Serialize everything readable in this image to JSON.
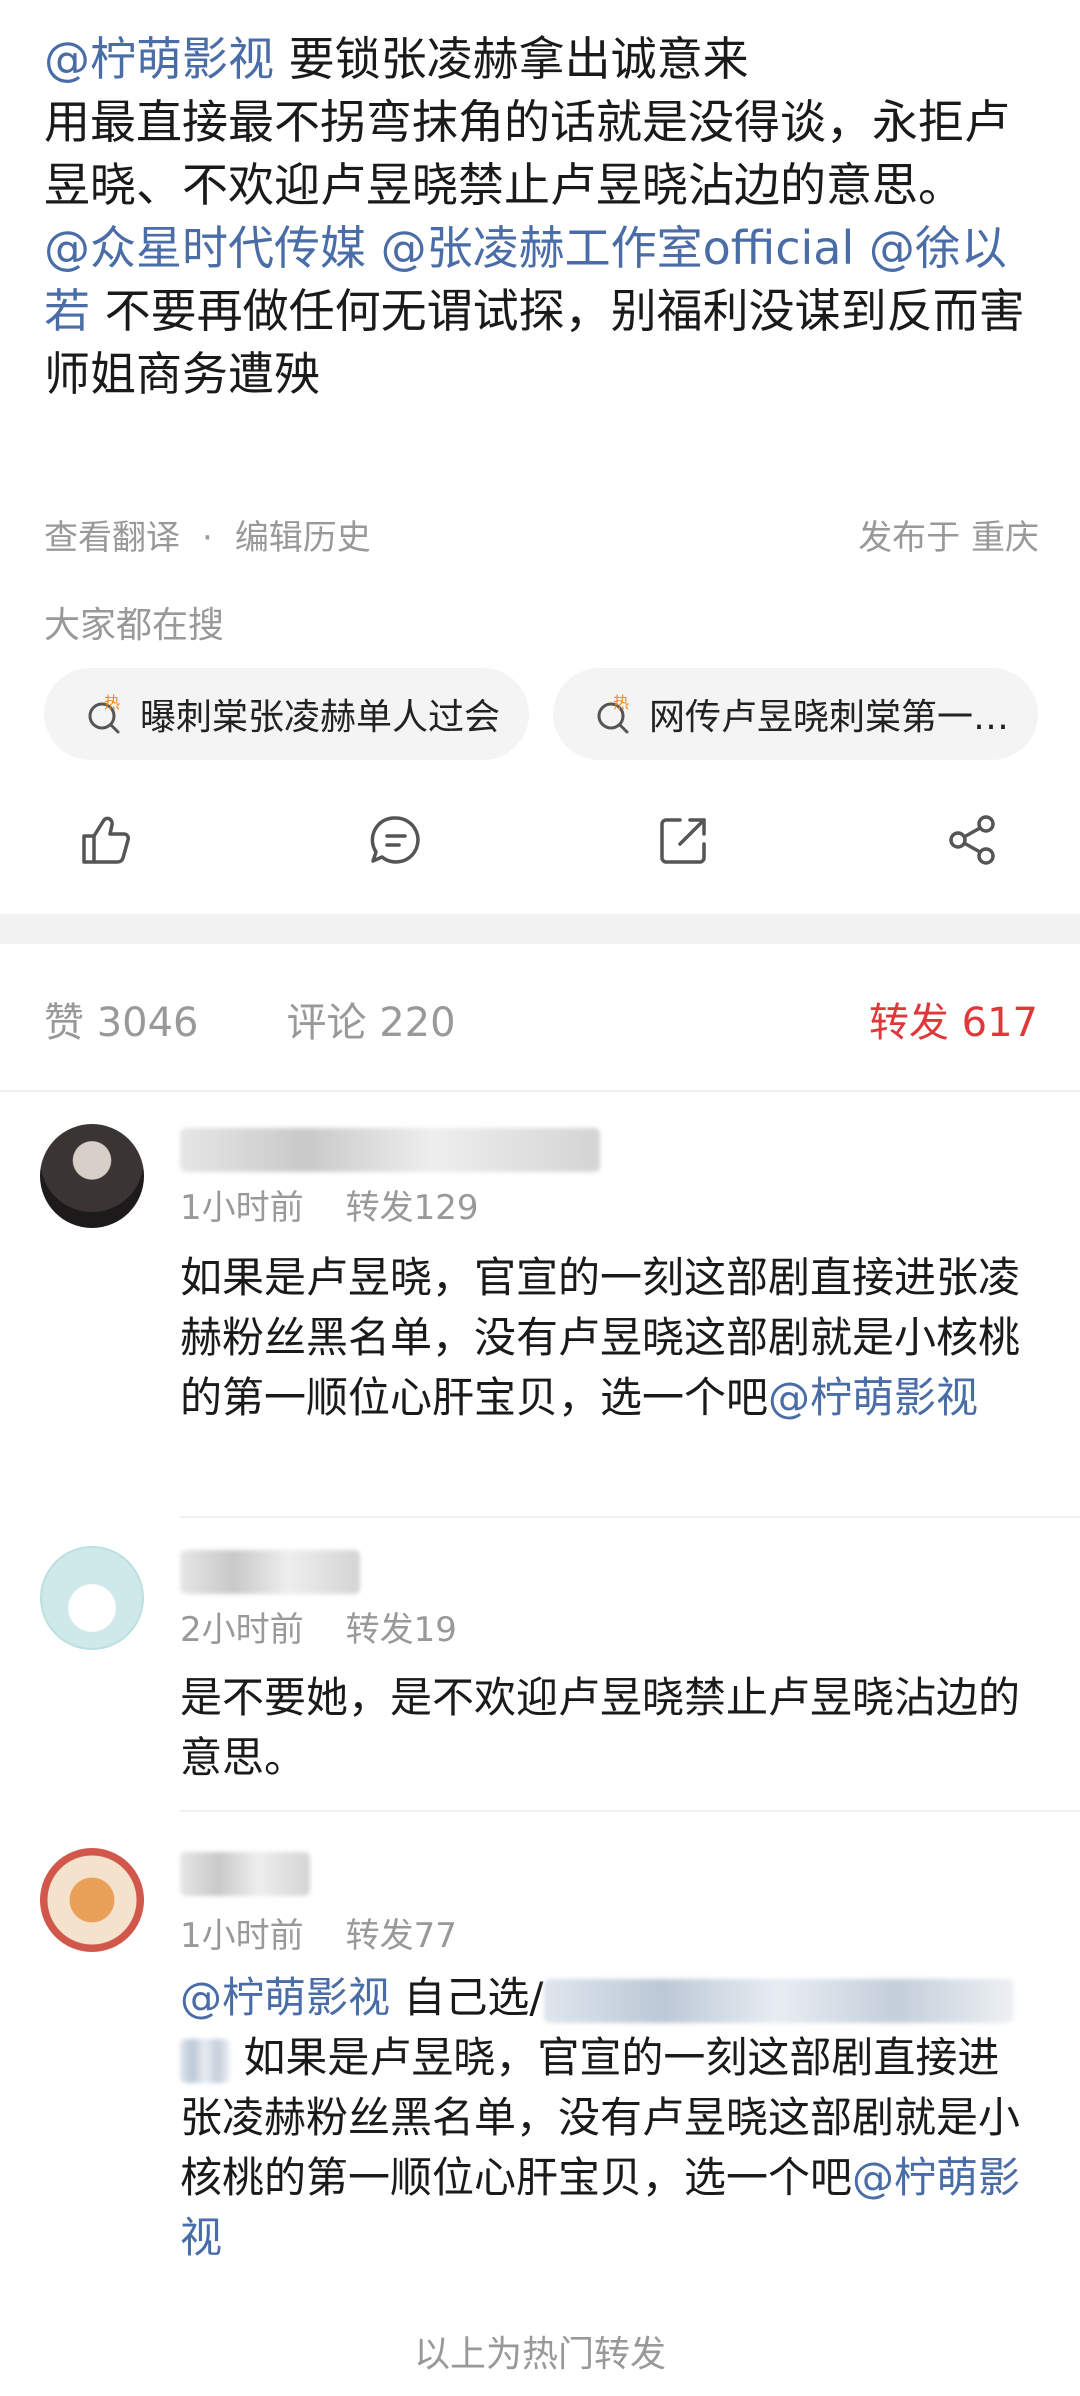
{
  "post": {
    "line1_mention": "@柠萌影视",
    "line1_text": " 要锁张凌赫拿出诚意来",
    "para2": "用最直接最不拐弯抹角的话就是没得谈，永拒卢昱晓、不欢迎卢昱晓禁止卢昱晓沾边的意思。",
    "mentions2": "@众星时代传媒 @张凌赫工作室official @徐以若",
    "text3": " 不要再做任何无谓试探，别福利没谋到反而害师姐商务遭殃"
  },
  "meta": {
    "translate": "查看翻译",
    "dot": "·",
    "edit_history": "编辑历史",
    "location": "发布于 重庆"
  },
  "search": {
    "title": "大家都在搜",
    "chips": [
      "曝刺棠张凌赫单人过会",
      "网传卢昱晓刺棠第一…"
    ],
    "hot_badge": "热"
  },
  "actions": [
    "like-icon",
    "comment-icon",
    "repost-icon",
    "share-icon"
  ],
  "tabs": {
    "likes": "赞 3046",
    "comments": "评论 220",
    "reposts": "转发 617"
  },
  "colors": {
    "mention": "#4a6da7",
    "active_tab": "#e0383a",
    "muted": "#999999"
  },
  "comments": [
    {
      "time": "1小时前",
      "reposts": "转发129",
      "text": "如果是卢昱晓，官宣的一刻这部剧直接进张凌赫粉丝黑名单，没有卢昱晓这部剧就是小核桃的第一顺位心肝宝贝，选一个吧",
      "tail_mention": "@柠萌影视"
    },
    {
      "time": "2小时前",
      "reposts": "转发19",
      "text": "是不要她，是不欢迎卢昱晓禁止卢昱晓沾边的意思。"
    },
    {
      "time": "1小时前",
      "reposts": "转发77",
      "lead_mention": "@柠萌影视",
      "lead_text": " 自己选/",
      "text": " 如果是卢昱晓，官宣的一刻这部剧直接进张凌赫粉丝黑名单，没有卢昱晓这部剧就是小核桃的第一顺位心肝宝贝，选一个吧",
      "tail_mention": "@柠萌影视"
    }
  ],
  "footer": "以上为热门转发"
}
